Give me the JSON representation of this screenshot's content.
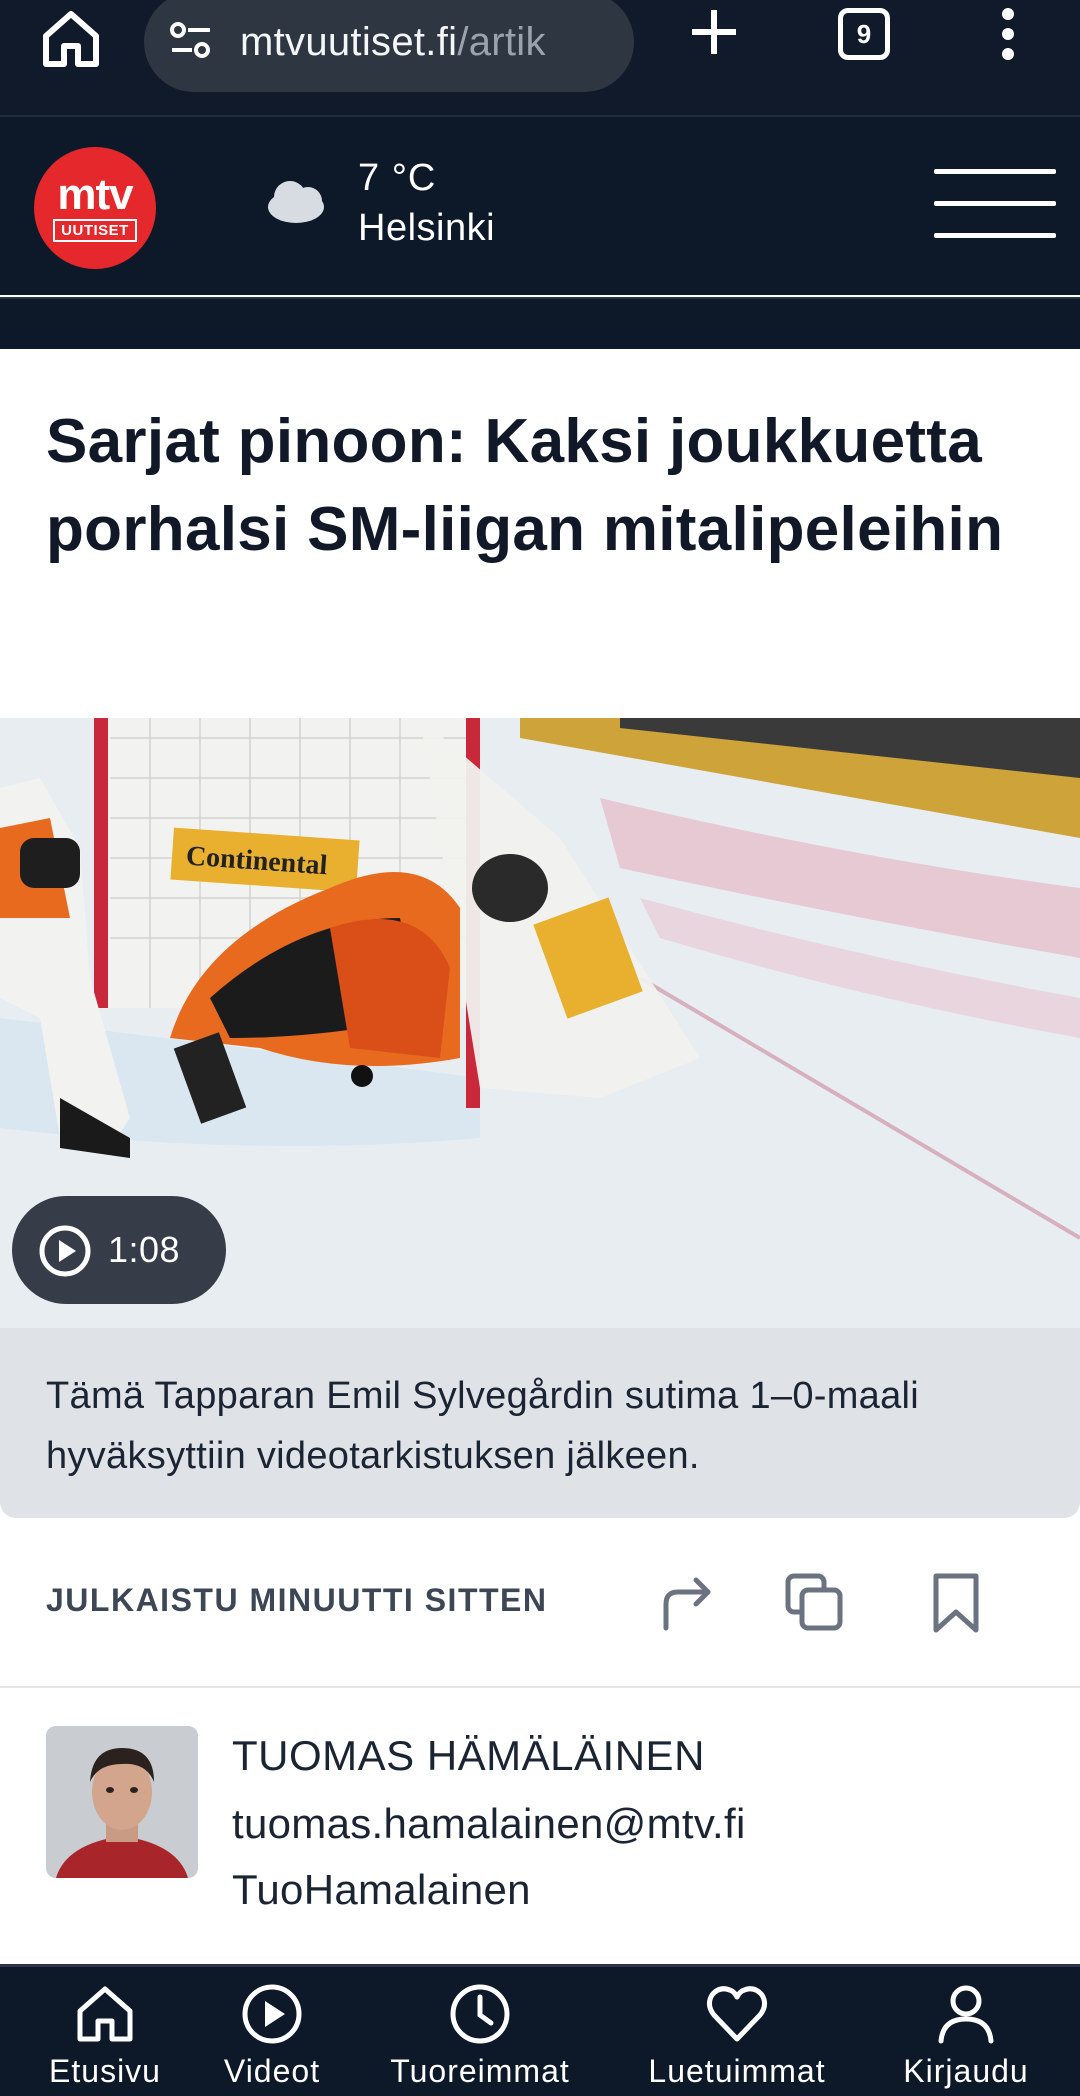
{
  "browser": {
    "url_host": "mtvuutiset.fi",
    "url_path": "/artik",
    "tab_count": "9"
  },
  "header": {
    "logo_top": "mtv",
    "logo_bottom": "UUTISET",
    "temperature": "7 °C",
    "city": "Helsinki"
  },
  "article": {
    "headline": "Sarjat pinoon: Kaksi joukkuetta porhalsi SM-liigan mitalipeleihin",
    "video_duration": "1:08",
    "caption": "Tämä Tapparan Emil Sylvegårdin sutima 1–0-maali hyväksyttiin videotarkistuksen jälkeen.",
    "published": "JULKAISTU MINUUTTI SITTEN"
  },
  "author": {
    "name": "TUOMAS HÄMÄLÄINEN",
    "email": "tuomas.hamalainen@mtv.fi",
    "handle": "TuoHamalainen"
  },
  "bottom_nav": {
    "items": [
      {
        "label": "Etusivu",
        "icon": "home-icon"
      },
      {
        "label": "Videot",
        "icon": "play-icon"
      },
      {
        "label": "Tuoreimmat",
        "icon": "clock-icon"
      },
      {
        "label": "Luetuimmat",
        "icon": "heart-icon"
      },
      {
        "label": "Kirjaudu",
        "icon": "user-icon"
      }
    ]
  },
  "colors": {
    "brand_red": "#e5282b",
    "header_navy": "#0d1829",
    "caption_bg": "#dfe2e7"
  }
}
